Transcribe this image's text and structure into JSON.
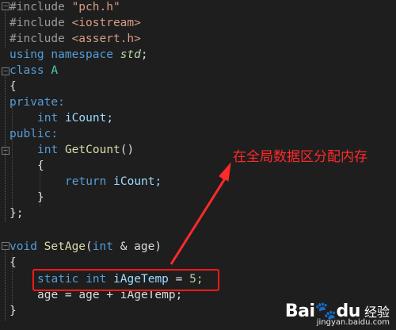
{
  "code": {
    "l1_hash": "#include",
    "l1_str": "\"pch.h\"",
    "l2_hash": "#include",
    "l2_str": "<iostream>",
    "l3_hash": "#include",
    "l3_str": "<assert.h>",
    "l4_using": "using",
    "l4_namespace": "namespace",
    "l4_std": "std",
    "l4_semi": ";",
    "l5_class": "class",
    "l5_name": "A",
    "l6": "{",
    "l7": "private:",
    "l8_type": "int",
    "l8_var": "iCount;",
    "l9": "public:",
    "l10_type": "int",
    "l10_fn": "GetCount",
    "l10_paren": "()",
    "l11": "{",
    "l12_kw": "return",
    "l12_var": "iCount;",
    "l13": "}",
    "l14": "};",
    "l16_void": "void",
    "l16_fn": "SetAge",
    "l16_open": "(",
    "l16_int": "int",
    "l16_rest": "& age)",
    "l17": "{",
    "l18_static": "static",
    "l18_int": "int",
    "l18_var": "iAgeTemp",
    "l18_eq": "=",
    "l18_num": "5;",
    "l19": "age = age + iAgeTemp;",
    "l20": "}"
  },
  "annotation": {
    "text": "在全局数据区分配内存",
    "color": "#ff2a2a"
  },
  "watermark": {
    "logo": "Bai",
    "logo2": "du",
    "experience": "经验",
    "url": "jingyan.baidu.com"
  },
  "colors": {
    "background": "#1e1e1e",
    "keyword": "#569cd6",
    "string": "#d69d85",
    "type_name": "#4ec9b0",
    "function": "#dcdcaa",
    "highlight_border": "#ff1a1a"
  }
}
